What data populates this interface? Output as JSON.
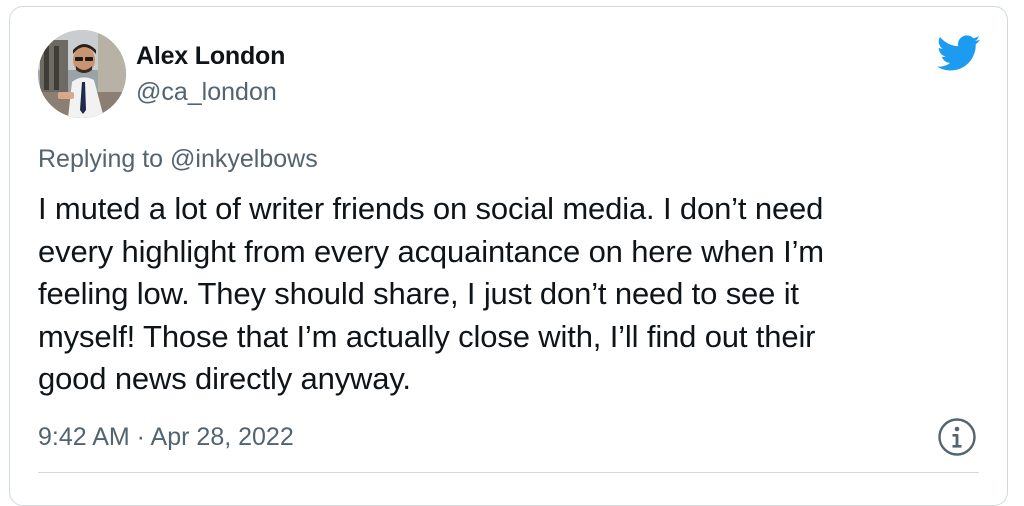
{
  "author": {
    "display_name": "Alex London",
    "handle": "@ca_london"
  },
  "reply": {
    "prefix": "Replying to ",
    "mention": "@inkyelbows"
  },
  "tweet": {
    "text": "I muted a lot of writer friends on social media.  I don’t need\nevery highlight from every acquaintance on here when I’m\nfeeling low. They should share, I just don’t need to see it\nmyself! Those that I’m actually close with, I’ll find out their\ngood news directly anyway.",
    "timestamp": "9:42 AM · Apr 28, 2022"
  },
  "icons": {
    "brand": "twitter-bird-icon",
    "info": "info-icon"
  },
  "colors": {
    "brand_blue": "#1d9bf0",
    "text_primary": "#0f1419",
    "text_secondary": "#536471",
    "border": "#cfd9de"
  }
}
